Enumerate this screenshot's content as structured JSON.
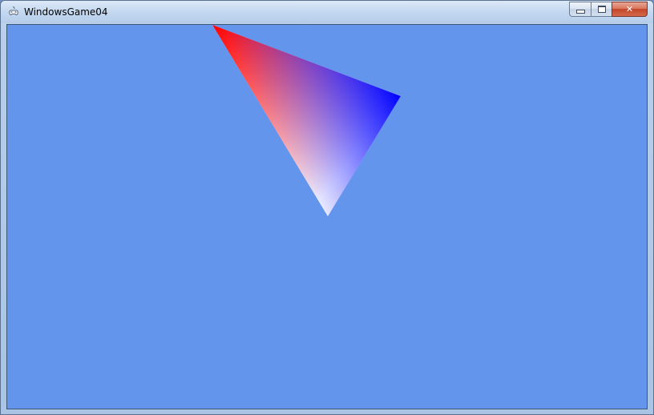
{
  "window": {
    "title": "WindowsGame04",
    "app_icon": "gamepad-icon",
    "controls": {
      "minimize_icon": "minimize-icon",
      "maximize_icon": "maximize-icon",
      "close_icon": "close-icon",
      "close_glyph": "✕"
    }
  },
  "viewport": {
    "clear_color": "#6495ED",
    "shape": "triangle",
    "vertex_colors": [
      "#FF0000",
      "#0000FF",
      "#FFFFFF"
    ]
  }
}
